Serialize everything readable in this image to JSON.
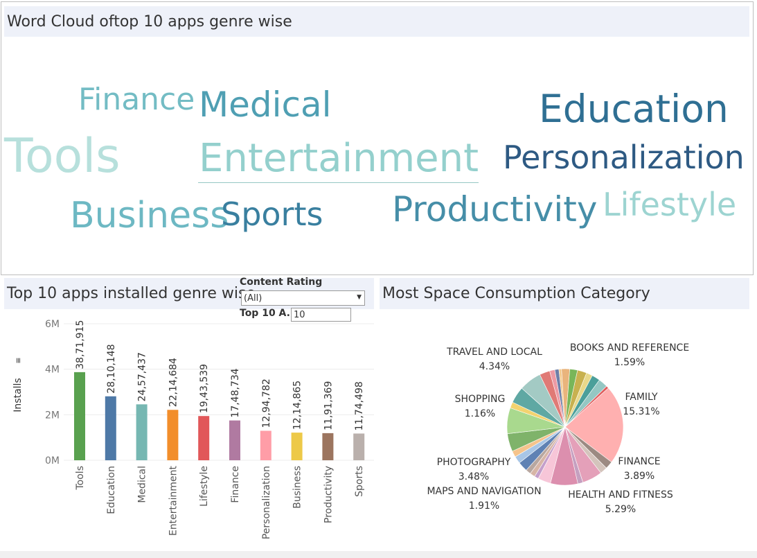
{
  "wordcloud": {
    "title": "Word Cloud oftop 10  apps genre wise",
    "words": [
      {
        "text": "Finance",
        "color": "#73bcc4"
      },
      {
        "text": "Medical",
        "color": "#4f9fb3"
      },
      {
        "text": "Education",
        "color": "#2f6f93"
      },
      {
        "text": "Tools",
        "color": "#b7e0dc"
      },
      {
        "text": "Entertainment",
        "color": "#94d0cd"
      },
      {
        "text": "Personalization",
        "color": "#2e5a83"
      },
      {
        "text": "Business",
        "color": "#6db8c3"
      },
      {
        "text": "Sports",
        "color": "#397f9f"
      },
      {
        "text": "Productivity",
        "color": "#468ea8"
      },
      {
        "text": "Lifestyle",
        "color": "#9dd4d1"
      }
    ]
  },
  "bar_panel": {
    "title": "Top 10 apps installed genre wise",
    "filter_label": "Content Rating",
    "filter_value": "(All)",
    "topn_label": "Top 10 A..",
    "topn_value": "10"
  },
  "pie_panel": {
    "title": "Most Space Consumption Category"
  },
  "chart_data": [
    {
      "type": "bar",
      "ylabel": "Installs",
      "ylim": [
        0,
        6000000
      ],
      "yticks": [
        0,
        2000000,
        4000000,
        6000000
      ],
      "ytick_labels": [
        "0M",
        "2M",
        "4M",
        "6M"
      ],
      "grid": true,
      "categories": [
        "Tools",
        "Education",
        "Medical",
        "Entertainment",
        "Lifestyle",
        "Finance",
        "Personalization",
        "Business",
        "Productivity",
        "Sports"
      ],
      "values": [
        3871915,
        2810148,
        2457437,
        2214684,
        1943539,
        1748734,
        1294782,
        1214865,
        1191369,
        1174498
      ],
      "value_labels": [
        "38,71,915",
        "28,10,148",
        "24,57,437",
        "22,14,684",
        "19,43,539",
        "17,48,734",
        "12,94,782",
        "12,14,865",
        "11,91,369",
        "11,74,498"
      ],
      "colors": [
        "#59a14f",
        "#4e79a7",
        "#76b7b2",
        "#f28e2b",
        "#e15759",
        "#b07aa1",
        "#ff9da7",
        "#edc948",
        "#9c755f",
        "#bab0ac"
      ]
    },
    {
      "type": "pie",
      "slices": [
        {
          "label": "FAMILY",
          "pct_label": "15.31%",
          "value": 15.31,
          "color": "#ffb0b0"
        },
        {
          "label": "",
          "pct_label": "",
          "value": 1.5,
          "color": "#9c8a82"
        },
        {
          "label": "",
          "pct_label": "",
          "value": 1.4,
          "color": "#d4c4bc"
        },
        {
          "label": "FINANCE",
          "pct_label": "3.89%",
          "value": 3.89,
          "color": "#e4a0b9"
        },
        {
          "label": "",
          "pct_label": "",
          "value": 1.0,
          "color": "#c5a0c0"
        },
        {
          "label": "HEALTH AND FITNESS",
          "pct_label": "5.29%",
          "value": 5.29,
          "color": "#dc8fae"
        },
        {
          "label": "",
          "pct_label": "",
          "value": 2.5,
          "color": "#f7c6d8"
        },
        {
          "label": "",
          "pct_label": "",
          "value": 0.8,
          "color": "#c49fca"
        },
        {
          "label": "",
          "pct_label": "",
          "value": 1.0,
          "color": "#d7b5a6"
        },
        {
          "label": "",
          "pct_label": "",
          "value": 1.0,
          "color": "#b8a7a0"
        },
        {
          "label": "MAPS AND NAVIGATION",
          "pct_label": "1.91%",
          "value": 1.91,
          "color": "#5f82b4"
        },
        {
          "label": "",
          "pct_label": "",
          "value": 1.4,
          "color": "#a8c6e6"
        },
        {
          "label": "",
          "pct_label": "",
          "value": 1.2,
          "color": "#f5c48c"
        },
        {
          "label": "PHOTOGRAPHY",
          "pct_label": "3.48%",
          "value": 3.48,
          "color": "#7fb36a"
        },
        {
          "label": "",
          "pct_label": "",
          "value": 5.0,
          "color": "#a9d98e"
        },
        {
          "label": "SHOPPING",
          "pct_label": "1.16%",
          "value": 1.16,
          "color": "#f2d36f"
        },
        {
          "label": "",
          "pct_label": "",
          "value": 3.2,
          "color": "#5fa8a3"
        },
        {
          "label": "TRAVEL AND LOCAL",
          "pct_label": "4.34%",
          "value": 4.34,
          "color": "#a3cac4"
        },
        {
          "label": "",
          "pct_label": "",
          "value": 2.0,
          "color": "#e07a76"
        },
        {
          "label": "",
          "pct_label": "",
          "value": 1.0,
          "color": "#ed9aa4"
        },
        {
          "label": "",
          "pct_label": "",
          "value": 0.8,
          "color": "#6e7fa8"
        },
        {
          "label": "",
          "pct_label": "",
          "value": 0.5,
          "color": "#f2c98c"
        },
        {
          "label": "BOOKS AND REFERENCE",
          "pct_label": "1.59%",
          "value": 1.59,
          "color": "#e9b47c"
        },
        {
          "label": "",
          "pct_label": "",
          "value": 1.5,
          "color": "#79b659"
        },
        {
          "label": "",
          "pct_label": "",
          "value": 1.8,
          "color": "#c8b14f"
        },
        {
          "label": "",
          "pct_label": "",
          "value": 1.2,
          "color": "#e8d88a"
        },
        {
          "label": "",
          "pct_label": "",
          "value": 1.6,
          "color": "#4b9f9a"
        },
        {
          "label": "",
          "pct_label": "",
          "value": 1.8,
          "color": "#94c7c3"
        },
        {
          "label": "",
          "pct_label": "",
          "value": 0.5,
          "color": "#e05f5f"
        }
      ]
    }
  ]
}
